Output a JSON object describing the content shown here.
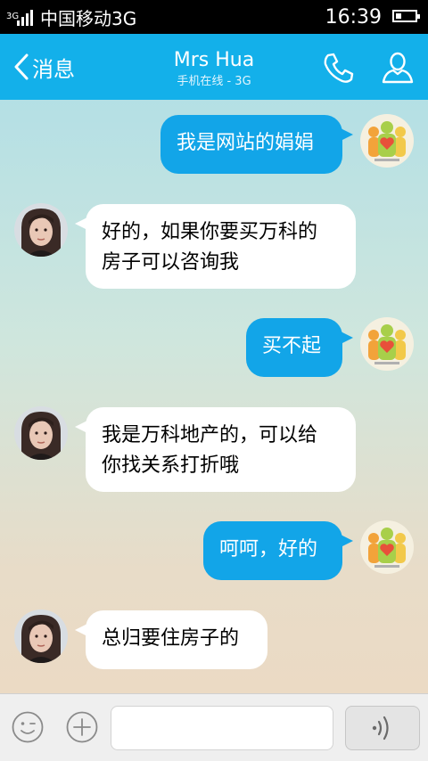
{
  "status_bar": {
    "network_badge": "3G",
    "carrier": "中国移动3G",
    "time": "16:39",
    "battery_level": 0.3
  },
  "header": {
    "back_label": "消息",
    "contact_name": "Mrs Hua",
    "status": "手机在线 - 3G",
    "call_icon": "phone-icon",
    "profile_icon": "person-icon"
  },
  "messages": [
    {
      "from": "me",
      "text": "我是网站的娟娟"
    },
    {
      "from": "contact",
      "text": "好的，如果你要买万科的\n房子可以咨询我"
    },
    {
      "from": "me",
      "text": "买不起"
    },
    {
      "from": "contact",
      "text": "我是万科地产的，可以给\n你找关系打折哦"
    },
    {
      "from": "me",
      "text": "呵呵，好的"
    },
    {
      "from": "contact",
      "text": "总归要住房子的"
    }
  ],
  "input_bar": {
    "emoji_icon": "emoji-icon",
    "plus_icon": "plus-icon",
    "message_value": "",
    "voice_icon": "voice-wave-icon"
  },
  "colors": {
    "header": "#13b0ea",
    "outgoing_bubble": "#12a5e8",
    "incoming_bubble": "#ffffff"
  }
}
